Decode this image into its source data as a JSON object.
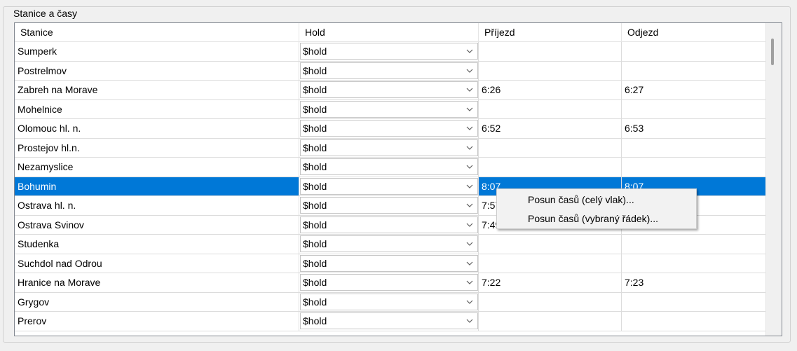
{
  "group": {
    "title": "Stanice a časy"
  },
  "columns": [
    "Stanice",
    "Hold",
    "Příjezd",
    "Odjezd"
  ],
  "rows": [
    {
      "station": "Sumperk",
      "hold": "$hold",
      "arrival": "",
      "departure": ""
    },
    {
      "station": "Postrelmov",
      "hold": "$hold",
      "arrival": "",
      "departure": ""
    },
    {
      "station": "Zabreh na Morave",
      "hold": "$hold",
      "arrival": "6:26",
      "departure": "6:27"
    },
    {
      "station": "Mohelnice",
      "hold": "$hold",
      "arrival": "",
      "departure": ""
    },
    {
      "station": "Olomouc hl. n.",
      "hold": "$hold",
      "arrival": "6:52",
      "departure": "6:53"
    },
    {
      "station": "Prostejov hl.n.",
      "hold": "$hold",
      "arrival": "",
      "departure": ""
    },
    {
      "station": "Nezamyslice",
      "hold": "$hold",
      "arrival": "",
      "departure": ""
    },
    {
      "station": "Bohumin",
      "hold": "$hold",
      "arrival": "8:07",
      "departure": "8:07",
      "selected": true
    },
    {
      "station": "Ostrava hl. n.",
      "hold": "$hold",
      "arrival": "7:57",
      "departure": ""
    },
    {
      "station": "Ostrava Svinov",
      "hold": "$hold",
      "arrival": "7:49",
      "departure": ""
    },
    {
      "station": "Studenka",
      "hold": "$hold",
      "arrival": "",
      "departure": ""
    },
    {
      "station": "Suchdol nad Odrou",
      "hold": "$hold",
      "arrival": "",
      "departure": ""
    },
    {
      "station": "Hranice na Morave",
      "hold": "$hold",
      "arrival": "7:22",
      "departure": "7:23"
    },
    {
      "station": "Grygov",
      "hold": "$hold",
      "arrival": "",
      "departure": ""
    },
    {
      "station": "Prerov",
      "hold": "$hold",
      "arrival": "",
      "departure": ""
    }
  ],
  "context_menu": {
    "items": [
      "Posun časů (celý vlak)...",
      "Posun časů (vybraný řádek)..."
    ]
  },
  "colors": {
    "selection": "#0078d7",
    "window_bg": "#f0f0f0"
  },
  "icons": {
    "combo_arrow": "chevron-down-icon"
  }
}
